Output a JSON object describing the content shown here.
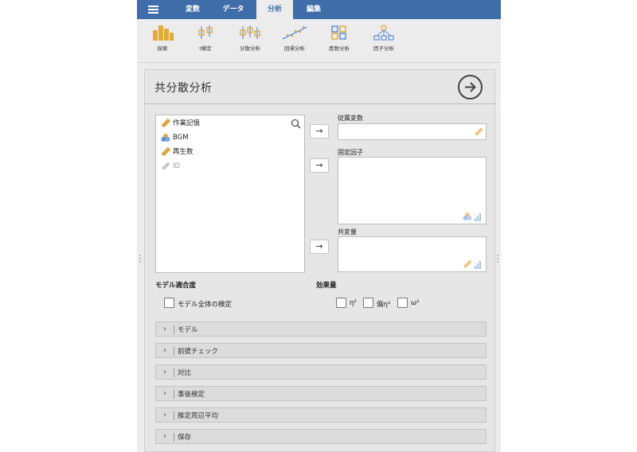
{
  "menu": {
    "tabs": [
      {
        "label": "変数"
      },
      {
        "label": "データ"
      },
      {
        "label": "分析"
      },
      {
        "label": "編集"
      }
    ]
  },
  "ribbon": {
    "buttons": [
      {
        "label": "探索",
        "icon": "explore-icon"
      },
      {
        "label": "t検定",
        "icon": "ttest-icon"
      },
      {
        "label": "分散分析",
        "icon": "anova-icon"
      },
      {
        "label": "回帰分析",
        "icon": "regression-icon"
      },
      {
        "label": "度数分析",
        "icon": "frequencies-icon"
      },
      {
        "label": "因子分析",
        "icon": "factor-icon"
      }
    ]
  },
  "panel": {
    "title": "共分散分析",
    "variables": [
      {
        "name": "作業記憶",
        "type": "continuous"
      },
      {
        "name": "BGM",
        "type": "nominal"
      },
      {
        "name": "再生数",
        "type": "continuous"
      },
      {
        "name": "ID",
        "type": "id"
      }
    ],
    "fields": {
      "dependent_label": "従属変数",
      "fixed_factors_label": "固定因子",
      "covariates_label": "共変量",
      "arrow": "→"
    },
    "model_fit": {
      "heading": "モデル適合度",
      "overall_test_label": "モデル全体の検定"
    },
    "effect_size": {
      "heading": "効果量",
      "eta_label": "η²",
      "partial_eta_label": "偏η²",
      "omega_label": "ω²"
    },
    "sections": [
      {
        "label": "モデル"
      },
      {
        "label": "前提チェック"
      },
      {
        "label": "対比"
      },
      {
        "label": "事後検定"
      },
      {
        "label": "推定周辺平均"
      },
      {
        "label": "保存"
      }
    ]
  },
  "colors": {
    "menubar": "#3e6da9",
    "accent_orange": "#e2a93c",
    "accent_blue": "#5c8fd6"
  }
}
